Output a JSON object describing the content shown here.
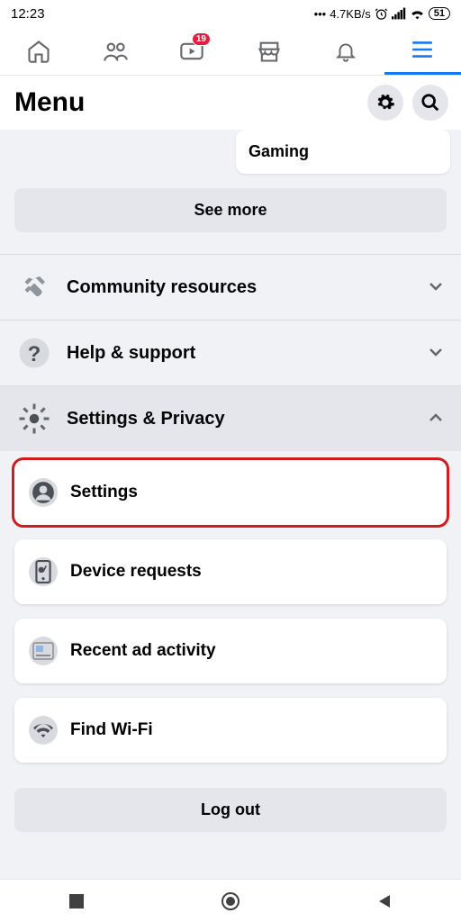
{
  "status": {
    "time": "12:23",
    "net": "4.7KB/s",
    "battery": "51"
  },
  "tabs": {
    "badge": "19"
  },
  "header": {
    "title": "Menu"
  },
  "shortcut": {
    "gaming": "Gaming"
  },
  "buttons": {
    "see_more": "See more",
    "log_out": "Log out"
  },
  "sections": {
    "community": "Community resources",
    "help": "Help & support",
    "settings_privacy": "Settings & Privacy"
  },
  "options": {
    "settings": "Settings",
    "device": "Device requests",
    "recent_ad": "Recent ad activity",
    "wifi": "Find Wi-Fi"
  }
}
